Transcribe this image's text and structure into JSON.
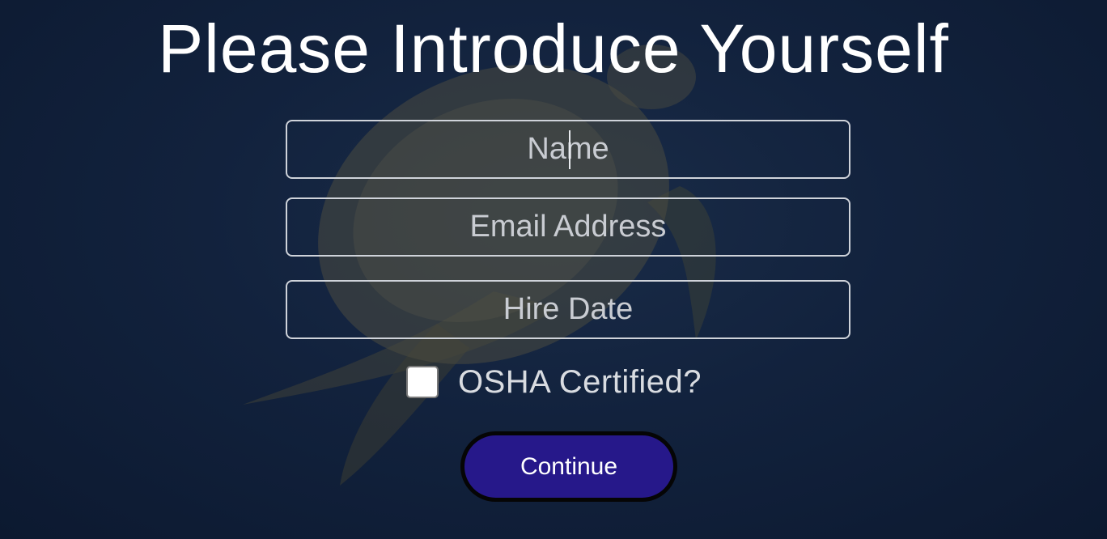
{
  "page": {
    "title": "Please Introduce Yourself"
  },
  "form": {
    "name": {
      "placeholder": "Name",
      "value": ""
    },
    "email": {
      "placeholder": "Email Address",
      "value": ""
    },
    "hire_date": {
      "placeholder": "Hire Date",
      "value": ""
    },
    "osha": {
      "label": "OSHA Certified?",
      "checked": false
    },
    "continue_label": "Continue"
  },
  "colors": {
    "background": "#0f1c33",
    "button": "#26188a",
    "text": "#ffffff"
  }
}
